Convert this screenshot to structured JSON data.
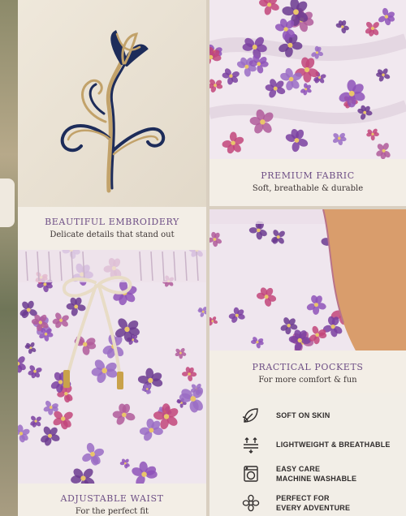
{
  "panels": {
    "embroidery": {
      "title": "BEAUTIFUL EMBROIDERY",
      "subtitle": "Delicate details that stand out"
    },
    "fabric": {
      "title": "PREMIUM FABRIC",
      "subtitle": "Soft, breathable & durable"
    },
    "pockets": {
      "title": "PRACTICAL POCKETS",
      "subtitle": "For more comfort & fun"
    },
    "waist": {
      "title": "ADJUSTABLE WAIST",
      "subtitle": "For the perfect fit"
    }
  },
  "features": [
    {
      "icon": "leaf-icon",
      "line1": "SOFT ON SKIN",
      "line2": ""
    },
    {
      "icon": "breathable-icon",
      "line1": "LIGHTWEIGHT & BREATHABLE",
      "line2": ""
    },
    {
      "icon": "washing-machine-icon",
      "line1": "EASY CARE",
      "line2": "MACHINE WASHABLE"
    },
    {
      "icon": "flower-icon",
      "line1": "PERFECT FOR",
      "line2": "EVERY ADVENTURE"
    }
  ],
  "colors": {
    "caption_title": "#6e4f86",
    "fabric_base": "#f1e8ef",
    "purple": "#7a3fa0",
    "pink": "#c2457a",
    "navy": "#1d2c5a",
    "gold": "#c2a26a"
  }
}
